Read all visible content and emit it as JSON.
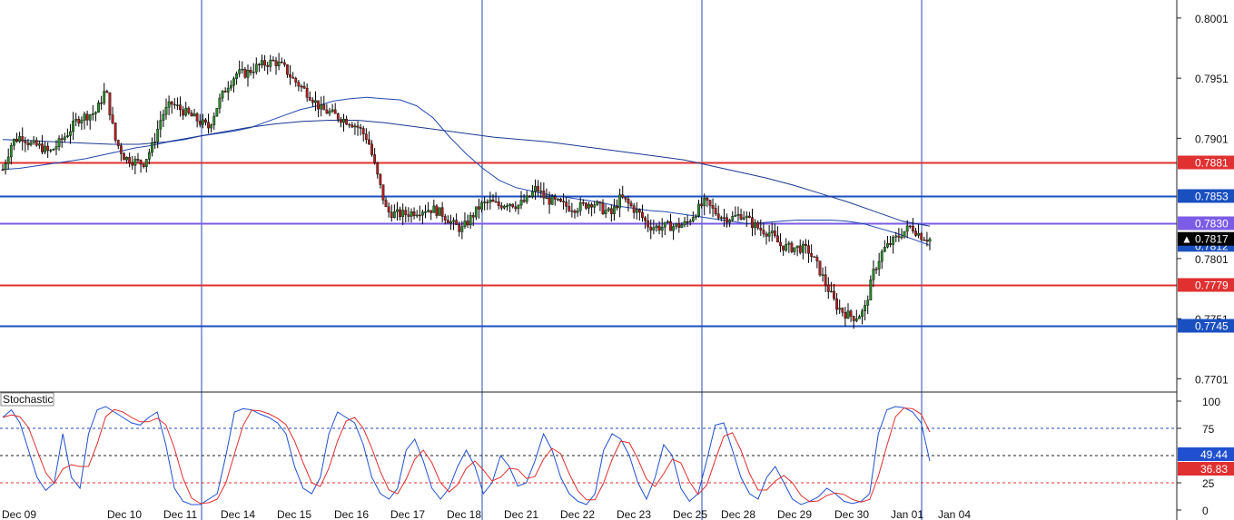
{
  "chart_data": {
    "type": "candlestick",
    "price_axis": {
      "ticks": [
        "0.8001",
        "0.7951",
        "0.7901",
        "0.7801",
        "0.7751",
        "0.7701"
      ],
      "tick_values": [
        0.8001,
        0.7951,
        0.7901,
        0.7801,
        0.7751,
        0.7701
      ],
      "ylim": [
        0.769,
        0.8016
      ]
    },
    "time_axis": {
      "labels": [
        "Dec 09",
        "Dec 10",
        "Dec 11",
        "Dec 14",
        "Dec 15",
        "Dec 16",
        "Dec 17",
        "Dec 18",
        "Dec 21",
        "Dec 22",
        "Dec 23",
        "Dec 25",
        "Dec 28",
        "Dec 29",
        "Dec 30",
        "Jan 01",
        "Jan 04"
      ],
      "period_separators": [
        "Dec 14",
        "Dec 21",
        "Dec 28",
        "Jan 04"
      ]
    },
    "horizontal_levels": [
      {
        "value": 0.7881,
        "label": "0.7881",
        "color": "#e03030"
      },
      {
        "value": 0.7853,
        "label": "0.7853",
        "color": "#1a4fc0"
      },
      {
        "value": 0.783,
        "label": "0.7830",
        "color": "#7b5ce6"
      },
      {
        "value": 0.7779,
        "label": "0.7779",
        "color": "#e03030"
      },
      {
        "value": 0.7745,
        "label": "0.7745",
        "color": "#1a4fc0"
      }
    ],
    "current_price": {
      "value": 0.7817,
      "label": "0.7817"
    },
    "ask_price": {
      "value": 0.7812,
      "label": "0.7812"
    },
    "close_series": [
      0.7875,
      0.7898,
      0.7903,
      0.7896,
      0.7894,
      0.7889,
      0.7897,
      0.7906,
      0.7917,
      0.792,
      0.7923,
      0.7942,
      0.79,
      0.7885,
      0.7882,
      0.788,
      0.7895,
      0.792,
      0.793,
      0.7925,
      0.792,
      0.7915,
      0.791,
      0.793,
      0.7945,
      0.7955,
      0.7955,
      0.796,
      0.7963,
      0.7965,
      0.796,
      0.795,
      0.7943,
      0.7935,
      0.7925,
      0.7922,
      0.7918,
      0.7915,
      0.791,
      0.79,
      0.787,
      0.784,
      0.7838,
      0.7838,
      0.784,
      0.7842,
      0.7842,
      0.7838,
      0.783,
      0.7825,
      0.7835,
      0.7845,
      0.7848,
      0.7845,
      0.7848,
      0.7845,
      0.785,
      0.786,
      0.785,
      0.7848,
      0.7845,
      0.7843,
      0.7845,
      0.7848,
      0.7842,
      0.7838,
      0.7852,
      0.7845,
      0.7838,
      0.7828,
      0.7827,
      0.7828,
      0.7828,
      0.783,
      0.784,
      0.7848,
      0.784,
      0.7835,
      0.7835,
      0.7838,
      0.783,
      0.7825,
      0.7822,
      0.7812,
      0.781,
      0.781,
      0.7808,
      0.7795,
      0.7778,
      0.7762,
      0.7755,
      0.7752,
      0.7757,
      0.779,
      0.7808,
      0.7815,
      0.7822,
      0.7828,
      0.782,
      0.7817
    ],
    "moving_averages": [
      {
        "values": [
          0.7875,
          0.7876,
          0.7878,
          0.788,
          0.7882,
          0.7884,
          0.7887,
          0.789,
          0.7893,
          0.7895,
          0.7898,
          0.79,
          0.7903,
          0.7905,
          0.7907,
          0.791,
          0.7915,
          0.792,
          0.7925,
          0.7928,
          0.7932,
          0.7934,
          0.7935,
          0.7934,
          0.7933,
          0.7928,
          0.7918,
          0.7902,
          0.7888,
          0.7876,
          0.7866,
          0.786,
          0.7857,
          0.7854,
          0.7852,
          0.785,
          0.7848,
          0.7845,
          0.7843,
          0.7841,
          0.784,
          0.7838,
          0.7836,
          0.7834,
          0.7832,
          0.783,
          0.7831,
          0.7832,
          0.7833,
          0.7833,
          0.7833,
          0.7832,
          0.783,
          0.7826,
          0.7822,
          0.7817,
          0.7812
        ],
        "color": "#2448b0"
      },
      {
        "values": [
          0.79,
          0.7899,
          0.7898,
          0.7897,
          0.7896,
          0.7896,
          0.7898,
          0.7902,
          0.7906,
          0.791,
          0.7913,
          0.7915,
          0.7916,
          0.7916,
          0.7914,
          0.7911,
          0.7908,
          0.7905,
          0.7902,
          0.79,
          0.7898,
          0.7895,
          0.7892,
          0.7889,
          0.7886,
          0.7883,
          0.7878,
          0.7873,
          0.7868,
          0.7862,
          0.7855,
          0.7848,
          0.784,
          0.7832,
          0.7828
        ],
        "color": "#1a3890"
      }
    ],
    "stochastic": {
      "title": "Stochastic",
      "axis_ticks": [
        "100",
        "75",
        "25",
        "0"
      ],
      "tick_values": [
        100,
        75,
        25,
        0
      ],
      "ylim": [
        0,
        100
      ],
      "levels": [
        75,
        50,
        25
      ],
      "main_label": "49.44",
      "signal_label": "36.83",
      "main_color": "#2050d0",
      "signal_color": "#e03030",
      "main_values": [
        85,
        92,
        80,
        55,
        30,
        18,
        25,
        70,
        30,
        20,
        70,
        92,
        95,
        90,
        85,
        80,
        78,
        85,
        90,
        60,
        20,
        8,
        5,
        5,
        10,
        15,
        50,
        90,
        93,
        92,
        88,
        85,
        80,
        70,
        40,
        20,
        15,
        30,
        70,
        90,
        85,
        80,
        60,
        30,
        15,
        10,
        20,
        55,
        65,
        45,
        20,
        10,
        20,
        40,
        55,
        40,
        15,
        25,
        50,
        40,
        22,
        25,
        45,
        70,
        55,
        30,
        15,
        8,
        5,
        15,
        55,
        70,
        65,
        50,
        25,
        10,
        30,
        60,
        50,
        20,
        8,
        15,
        45,
        78,
        80,
        55,
        30,
        15,
        10,
        30,
        40,
        25,
        10,
        5,
        8,
        12,
        20,
        15,
        8,
        6,
        8,
        15,
        70,
        92,
        95,
        94,
        90,
        80,
        45
      ]
    }
  }
}
